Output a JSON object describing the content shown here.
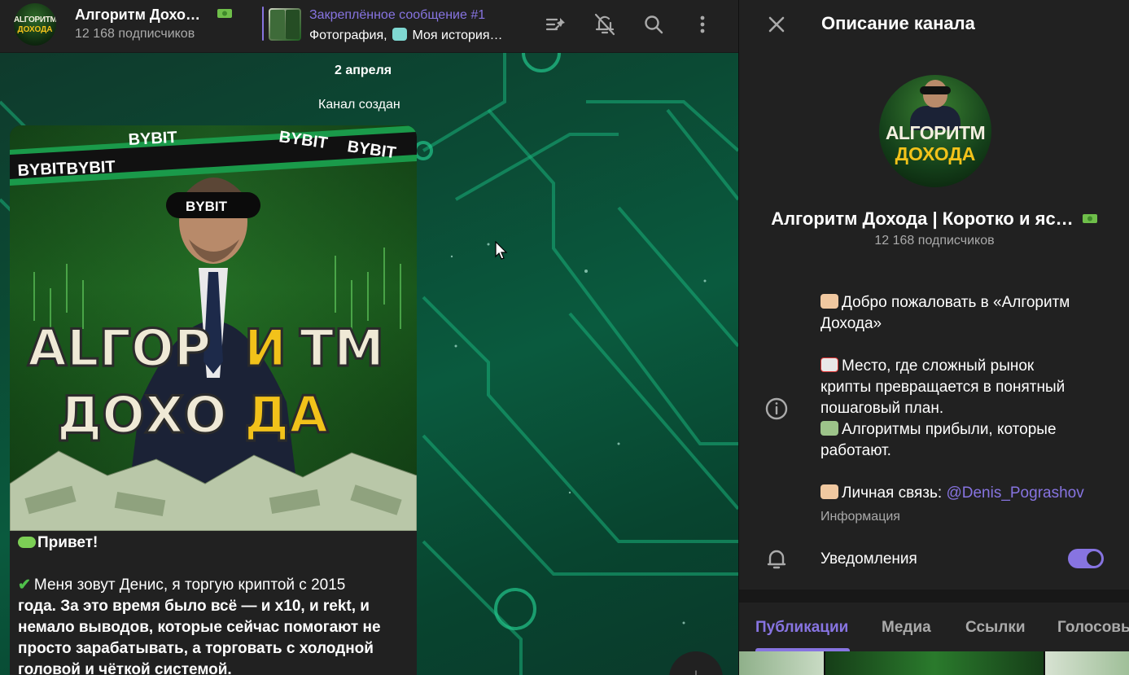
{
  "header": {
    "channel_title": "Алгоритм Дохо…",
    "subscribers": "12 168 подписчиков",
    "avatar_line1": "ALГОРИТМ",
    "avatar_line2": "ДОХОДА",
    "pinned": {
      "title": "Закреплённое сообщение #1",
      "text_prefix": "Фотография,",
      "text_suffix": "Моя история…"
    },
    "icons": [
      "pinned-list-icon",
      "mute-bell-icon",
      "search-icon",
      "more-vertical-icon"
    ]
  },
  "chat": {
    "date": "2 апреля",
    "service_message": "Канал создан",
    "post": {
      "image": {
        "brand_tape": "BYBIT",
        "title_line1_a": "ALГОР",
        "title_line1_b": "И",
        "title_line1_c": "ТМ",
        "title_line2_a": "ДОХО",
        "title_line2_b": "ДА"
      },
      "greeting": "Привет!",
      "intro_normal": "Меня зовут Денис, я торгую криптой с 2015",
      "intro_bold_1": "года. За это время было всё — и x10, и rekt, и",
      "intro_bold_2": "немало выводов, которые сейчас помогают не",
      "intro_bold_3": "просто зарабатывать, а торговать с холодной",
      "intro_bold_4": "головой и чёткой системой."
    }
  },
  "panel": {
    "title": "Описание канала",
    "channel_name": "Алгоритм Дохода | Коротко и яс…",
    "subscribers": "12 168 подписчиков",
    "avatar_line1": "ALГОРИТМ",
    "avatar_line2": "ДОХОДА",
    "description": {
      "line1": "Добро пожаловать в «Алгоритм",
      "line2": "Дохода»",
      "line3": "Место, где сложный рынок",
      "line4": "крипты превращается в понятный",
      "line5": "пошаговый план.",
      "line6": "Алгоритмы прибыли, которые",
      "line7": "работают.",
      "line8_prefix": "Личная связь: ",
      "line8_link": "@Denis_Pograshov"
    },
    "description_label": "Информация",
    "notifications_label": "Уведомления",
    "notifications_on": true,
    "tabs": [
      "Публикации",
      "Медиа",
      "Ссылки",
      "Голосовые"
    ],
    "active_tab": "Публикации"
  },
  "colors": {
    "accent": "#8774e1",
    "bg": "#212121",
    "secondary_text": "#aaaaaa",
    "bg_green": "#0a5a3e",
    "highlight_yellow": "#f2c21a"
  }
}
